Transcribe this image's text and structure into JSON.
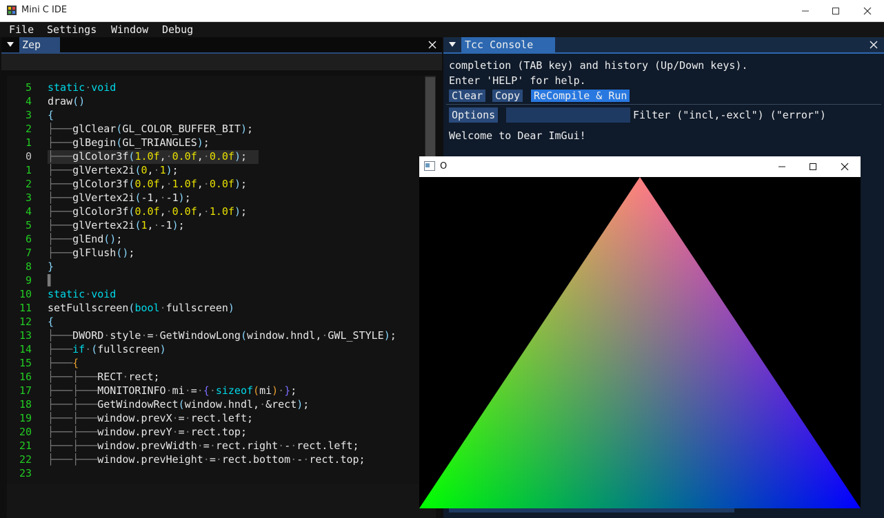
{
  "app": {
    "title": "Mini C IDE"
  },
  "menu": [
    "File",
    "Settings",
    "Window",
    "Debug"
  ],
  "zep": {
    "tab_label": "Zep",
    "lines": [
      {
        "n": "5",
        "t": [
          [
            "kw",
            "static"
          ],
          [
            "gr",
            "·"
          ],
          [
            "kw",
            "void"
          ]
        ]
      },
      {
        "n": "4",
        "t": [
          [
            "tx",
            "draw"
          ],
          [
            "pr",
            "()"
          ]
        ]
      },
      {
        "n": "3",
        "t": [
          [
            "pr",
            "{"
          ]
        ]
      },
      {
        "n": "2",
        "t": [
          [
            "gr",
            "├───"
          ],
          [
            "tx",
            "glClear"
          ],
          [
            "pr",
            "("
          ],
          [
            "tx",
            "GL_COLOR_BUFFER_BIT"
          ],
          [
            "pr",
            ")"
          ],
          [
            "tx",
            ";"
          ]
        ]
      },
      {
        "n": "1",
        "t": [
          [
            "gr",
            "├───"
          ],
          [
            "tx",
            "glBegin"
          ],
          [
            "pr",
            "("
          ],
          [
            "tx",
            "GL_TRIANGLES"
          ],
          [
            "pr",
            ")"
          ],
          [
            "tx",
            ";"
          ]
        ]
      },
      {
        "n": "0",
        "t": [
          [
            "gr",
            "├───"
          ],
          [
            "tx",
            "glColor3f"
          ],
          [
            "pr",
            "("
          ],
          [
            "nm",
            "1.0f"
          ],
          [
            "tx",
            ","
          ],
          [
            "gr",
            "·"
          ],
          [
            "nm",
            "0.0f"
          ],
          [
            "tx",
            ","
          ],
          [
            "gr",
            "·"
          ],
          [
            "nm",
            "0.0f"
          ],
          [
            "pr",
            ")"
          ],
          [
            "tx",
            ";"
          ]
        ],
        "current": true
      },
      {
        "n": "1",
        "t": [
          [
            "gr",
            "├───"
          ],
          [
            "tx",
            "glVertex2i"
          ],
          [
            "pr",
            "("
          ],
          [
            "nm",
            "0"
          ],
          [
            "tx",
            ","
          ],
          [
            "gr",
            "·"
          ],
          [
            "nm",
            "1"
          ],
          [
            "pr",
            ")"
          ],
          [
            "tx",
            ";"
          ]
        ]
      },
      {
        "n": "2",
        "t": [
          [
            "gr",
            "├───"
          ],
          [
            "tx",
            "glColor3f"
          ],
          [
            "pr",
            "("
          ],
          [
            "nm",
            "0.0f"
          ],
          [
            "tx",
            ","
          ],
          [
            "gr",
            "·"
          ],
          [
            "nm",
            "1.0f"
          ],
          [
            "tx",
            ","
          ],
          [
            "gr",
            "·"
          ],
          [
            "nm",
            "0.0f"
          ],
          [
            "pr",
            ")"
          ],
          [
            "tx",
            ";"
          ]
        ]
      },
      {
        "n": "3",
        "t": [
          [
            "gr",
            "├───"
          ],
          [
            "tx",
            "glVertex2i"
          ],
          [
            "pr",
            "("
          ],
          [
            "tx",
            "-1,"
          ],
          [
            "gr",
            "·"
          ],
          [
            "tx",
            "-1"
          ],
          [
            "pr",
            ")"
          ],
          [
            "tx",
            ";"
          ]
        ]
      },
      {
        "n": "4",
        "t": [
          [
            "gr",
            "├───"
          ],
          [
            "tx",
            "glColor3f"
          ],
          [
            "pr",
            "("
          ],
          [
            "nm",
            "0.0f"
          ],
          [
            "tx",
            ","
          ],
          [
            "gr",
            "·"
          ],
          [
            "nm",
            "0.0f"
          ],
          [
            "tx",
            ","
          ],
          [
            "gr",
            "·"
          ],
          [
            "nm",
            "1.0f"
          ],
          [
            "pr",
            ")"
          ],
          [
            "tx",
            ";"
          ]
        ]
      },
      {
        "n": "5",
        "t": [
          [
            "gr",
            "├───"
          ],
          [
            "tx",
            "glVertex2i"
          ],
          [
            "pr",
            "("
          ],
          [
            "nm",
            "1"
          ],
          [
            "tx",
            ","
          ],
          [
            "gr",
            "·"
          ],
          [
            "tx",
            "-1"
          ],
          [
            "pr",
            ")"
          ],
          [
            "tx",
            ";"
          ]
        ]
      },
      {
        "n": "6",
        "t": [
          [
            "gr",
            "├───"
          ],
          [
            "tx",
            "glEnd"
          ],
          [
            "pr",
            "()"
          ],
          [
            "tx",
            ";"
          ]
        ]
      },
      {
        "n": "7",
        "t": [
          [
            "gr",
            "├───"
          ],
          [
            "tx",
            "glFlush"
          ],
          [
            "pr",
            "()"
          ],
          [
            "tx",
            ";"
          ]
        ]
      },
      {
        "n": "8",
        "t": [
          [
            "pr",
            "}"
          ]
        ]
      },
      {
        "n": "9",
        "t": [
          [
            "gr",
            "▌"
          ]
        ]
      },
      {
        "n": "10",
        "t": [
          [
            "kw",
            "static"
          ],
          [
            "gr",
            "·"
          ],
          [
            "kw",
            "void"
          ]
        ]
      },
      {
        "n": "11",
        "t": [
          [
            "tx",
            "setFullscreen"
          ],
          [
            "pr",
            "("
          ],
          [
            "kw",
            "bool"
          ],
          [
            "gr",
            "·"
          ],
          [
            "tx",
            "fullscreen"
          ],
          [
            "pr",
            ")"
          ]
        ]
      },
      {
        "n": "12",
        "t": [
          [
            "pr",
            "{"
          ]
        ]
      },
      {
        "n": "13",
        "t": [
          [
            "gr",
            "├───"
          ],
          [
            "tx",
            "DWORD"
          ],
          [
            "gr",
            "·"
          ],
          [
            "tx",
            "style"
          ],
          [
            "gr",
            "·"
          ],
          [
            "tx",
            "="
          ],
          [
            "gr",
            "·"
          ],
          [
            "tx",
            "GetWindowLong"
          ],
          [
            "pr",
            "("
          ],
          [
            "tx",
            "window.hndl,"
          ],
          [
            "gr",
            "·"
          ],
          [
            "tx",
            "GWL_STYLE"
          ],
          [
            "pr",
            ")"
          ],
          [
            "tx",
            ";"
          ]
        ]
      },
      {
        "n": "14",
        "t": [
          [
            "gr",
            "├───"
          ],
          [
            "kw",
            "if"
          ],
          [
            "gr",
            "·"
          ],
          [
            "pr",
            "("
          ],
          [
            "tx",
            "fullscreen"
          ],
          [
            "pr",
            ")"
          ]
        ]
      },
      {
        "n": "15",
        "t": [
          [
            "gr",
            "├───"
          ],
          [
            "br",
            "{"
          ]
        ]
      },
      {
        "n": "16",
        "t": [
          [
            "gr",
            "├───├───"
          ],
          [
            "tx",
            "RECT"
          ],
          [
            "gr",
            "·"
          ],
          [
            "tx",
            "rect;"
          ]
        ]
      },
      {
        "n": "17",
        "t": [
          [
            "gr",
            "├───├───"
          ],
          [
            "tx",
            "MONITORINFO"
          ],
          [
            "gr",
            "·"
          ],
          [
            "tx",
            "mi"
          ],
          [
            "gr",
            "·"
          ],
          [
            "tx",
            "="
          ],
          [
            "gr",
            "·"
          ],
          [
            "pu",
            "{"
          ],
          [
            "gr",
            "·"
          ],
          [
            "kw",
            "sizeof"
          ],
          [
            "br",
            "("
          ],
          [
            "tx",
            "mi"
          ],
          [
            "br",
            ")"
          ],
          [
            "gr",
            "·"
          ],
          [
            "pu",
            "}"
          ],
          [
            "tx",
            ";"
          ]
        ]
      },
      {
        "n": "18",
        "t": [
          [
            "gr",
            "├───├───"
          ],
          [
            "tx",
            "GetWindowRect"
          ],
          [
            "pr",
            "("
          ],
          [
            "tx",
            "window.hndl,"
          ],
          [
            "gr",
            "·"
          ],
          [
            "tx",
            "&rect"
          ],
          [
            "pr",
            ")"
          ],
          [
            "tx",
            ";"
          ]
        ]
      },
      {
        "n": "19",
        "t": [
          [
            "gr",
            "├───├───"
          ],
          [
            "tx",
            "window.prevX"
          ],
          [
            "gr",
            "·"
          ],
          [
            "tx",
            "="
          ],
          [
            "gr",
            "·"
          ],
          [
            "tx",
            "rect.left;"
          ]
        ]
      },
      {
        "n": "20",
        "t": [
          [
            "gr",
            "├───├───"
          ],
          [
            "tx",
            "window.prevY"
          ],
          [
            "gr",
            "·"
          ],
          [
            "tx",
            "="
          ],
          [
            "gr",
            "·"
          ],
          [
            "tx",
            "rect.top;"
          ]
        ]
      },
      {
        "n": "21",
        "t": [
          [
            "gr",
            "├───├───"
          ],
          [
            "tx",
            "window.prevWidth"
          ],
          [
            "gr",
            "·"
          ],
          [
            "tx",
            "="
          ],
          [
            "gr",
            "·"
          ],
          [
            "tx",
            "rect.right"
          ],
          [
            "gr",
            "·"
          ],
          [
            "tx",
            "-"
          ],
          [
            "gr",
            "·"
          ],
          [
            "tx",
            "rect.left;"
          ]
        ]
      },
      {
        "n": "22",
        "t": [
          [
            "gr",
            "├───├───"
          ],
          [
            "tx",
            "window.prevHeight"
          ],
          [
            "gr",
            "·"
          ],
          [
            "tx",
            "="
          ],
          [
            "gr",
            "·"
          ],
          [
            "tx",
            "rect.bottom"
          ],
          [
            "gr",
            "·"
          ],
          [
            "tx",
            "-"
          ],
          [
            "gr",
            "·"
          ],
          [
            "tx",
            "rect.top;"
          ]
        ]
      },
      {
        "n": "23",
        "t": []
      }
    ]
  },
  "tcc": {
    "tab_label": "Tcc Console",
    "intro_line1": "completion (TAB key) and history (Up/Down keys).",
    "intro_line2": "Enter 'HELP' for help.",
    "buttons": {
      "clear": "Clear",
      "copy": "Copy",
      "recompile": "ReCompile & Run"
    },
    "options_label": "Options",
    "filter_value": "",
    "filter_label": "Filter (\"incl,-excl\") (\"error\")",
    "output": "Welcome to Dear ImGui!"
  },
  "gl_window": {
    "title": "O",
    "vertex_colors": [
      "#ff0000",
      "#00ff00",
      "#0000ff"
    ]
  },
  "colors": {
    "accent": "#2d68b0",
    "line_number": "#22cc22",
    "keyword": "#00d8e8",
    "number": "#e8e000"
  }
}
